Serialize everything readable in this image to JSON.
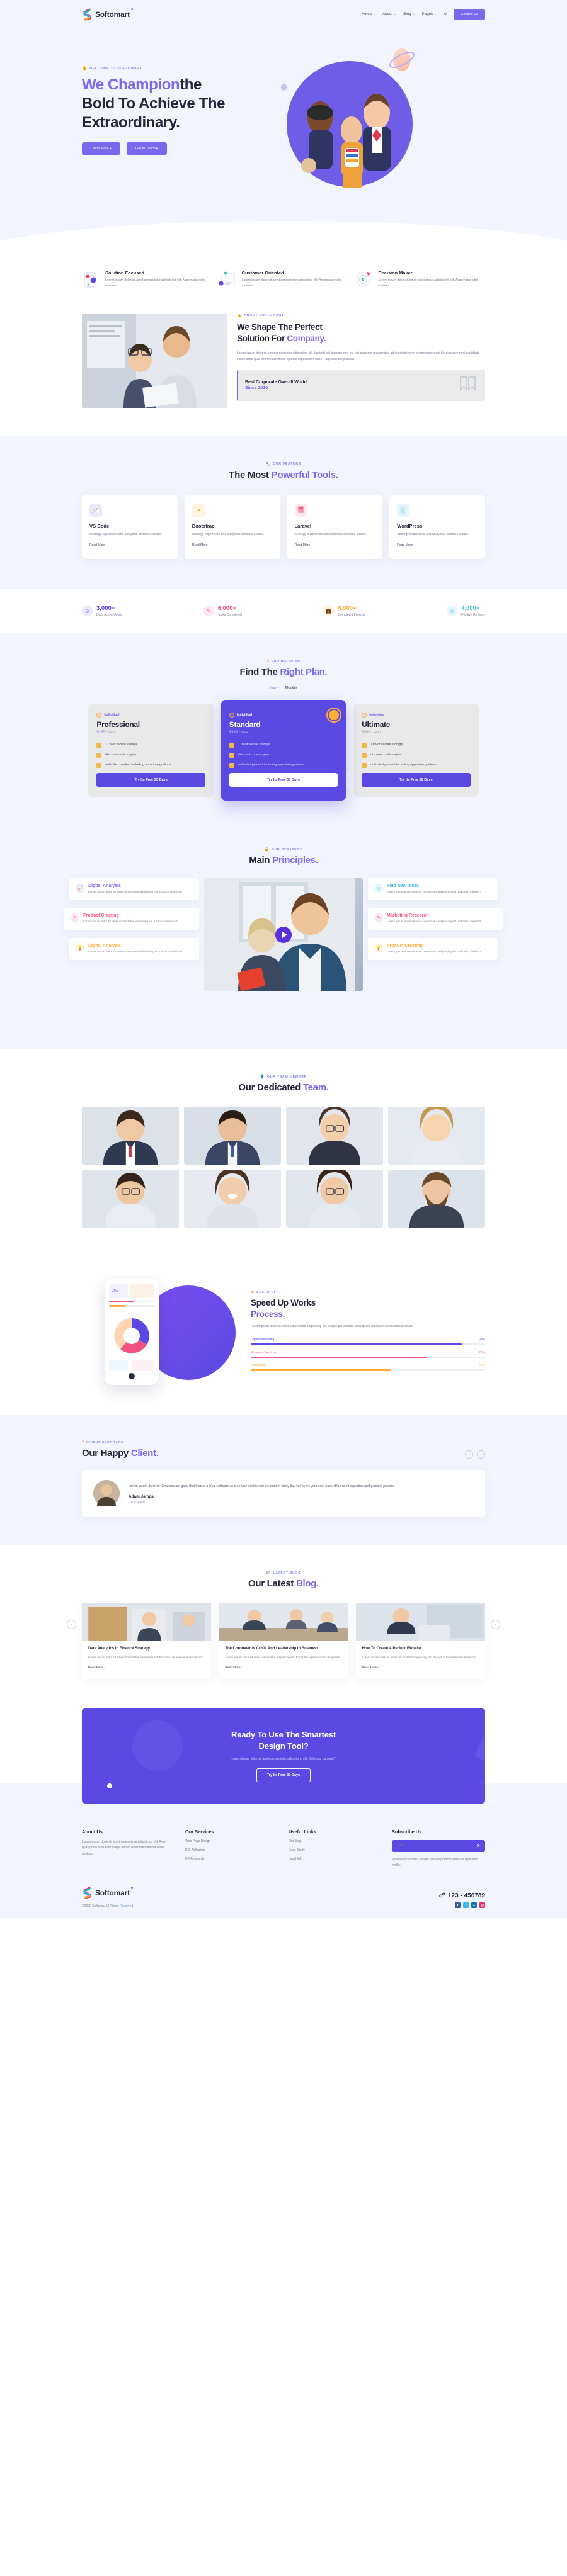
{
  "brand": {
    "name": "Softomart",
    "accent": "#7b68ee"
  },
  "header": {
    "nav": [
      {
        "label": "Home",
        "caret": true
      },
      {
        "label": "About",
        "caret": true
      },
      {
        "label": "Blog",
        "caret": true
      },
      {
        "label": "Pages",
        "caret": true
      }
    ],
    "search_icon": "search-icon",
    "cta": "Contact Us"
  },
  "hero": {
    "eyebrow": "WELCOME TO SOFTOMART",
    "title_accent": "We Champion",
    "title_rest": "the",
    "title_line2": "Bold To Achieve The",
    "title_line3": "Extraordinary.",
    "btn_primary": "Learn More",
    "btn_secondary": "Get In Touch"
  },
  "features": [
    {
      "title": "Solution Focused",
      "desc": "Lorem ipsum dolor sit,amet consectetur adipisicing elit. Aspernatur odio maiores.",
      "icon": "card-shape-icon"
    },
    {
      "title": "Customer Oriented",
      "desc": "Lorem ipsum dolor sit,amet consectetur adipisicing elit. Aspernatur odio maiores.",
      "icon": "node-network-icon"
    },
    {
      "title": "Decision Maker",
      "desc": "Lorem ipsum dolor sit,amet consectetur adipisicing elit. Aspernatur odio maiores.",
      "icon": "target-icon"
    }
  ],
  "about": {
    "eyebrow": "ABOUT SOFTOMART",
    "title1": "We Shape The Perfect",
    "title2": "Solution For ",
    "title_accent": "Company.",
    "paragraph": "Lorem ipsum dolor,sit amet consectetur adipisicing elit. Veritatis vel aperiam non est nisi sapiente recusandae ad exercitationem temporibus sequi hic eius commodi,cupiditate consectetur quia dolores architecto quidem dignissimos unde. Repudiandae pariatur.",
    "award_title": "Best Corporate Overall World",
    "award_since": "Since 2010"
  },
  "tools": {
    "eyebrow": "OUR FEATURE",
    "title": "The Most ",
    "title_accent": "Powerful Tools.",
    "cards": [
      {
        "name": "VS Code",
        "desc": "Strategy experience and analytical combine enable.",
        "more": "Read More",
        "icon": "chart-line-icon",
        "bg": "#ebe8fd",
        "fg": "#6f5de8"
      },
      {
        "name": "Bootstrap",
        "desc": "Strategy experience and analytical combine enable.",
        "more": "Read More",
        "icon": "pie-chart-icon",
        "bg": "#fff3e0",
        "fg": "#ffab3f"
      },
      {
        "name": "Laravel",
        "desc": "Strategy experience and analytical combine enable.",
        "more": "Read More",
        "icon": "monitor-icon",
        "bg": "#fde8ee",
        "fg": "#f2537e"
      },
      {
        "name": "WordPress",
        "desc": "Strategy experience and analytical combine enable.",
        "more": "Read More",
        "icon": "wordpress-icon",
        "bg": "#e2f6fb",
        "fg": "#3bb8dd"
      }
    ]
  },
  "counters": [
    {
      "value": "3,000+",
      "label": "Daily Active Users",
      "color": "#5a4ae3",
      "bg": "#ebe8fd",
      "icon": "user-icon"
    },
    {
      "value": "6,000+",
      "label": "Tasks Completed",
      "color": "#f2537e",
      "bg": "#fde8ee",
      "icon": "edit-icon"
    },
    {
      "value": "8,000+",
      "label": "Completed Projects",
      "color": "#ffab3f",
      "bg": "#fff3e0",
      "icon": "briefcase-icon"
    },
    {
      "value": "4,000+",
      "label": "Positive Reviews",
      "color": "#3bb8dd",
      "bg": "#e2f6fb",
      "icon": "smile-icon"
    }
  ],
  "pricing": {
    "eyebrow": "PRICING PLAN",
    "title": "Find The ",
    "title_accent": "Right Plan.",
    "toggle_yearly": "Yearly",
    "toggle_monthly": "Monthly",
    "plans": [
      {
        "tag": "Individual",
        "name": "Professional",
        "price": "$120",
        "period": " / Year",
        "features": [
          "1TB of secure storage",
          "discount code engine",
          "unlimited product including apps intergrations"
        ],
        "button": "Try Its Free 30 Days",
        "highlight": false
      },
      {
        "tag": "Individual",
        "name": "Standard",
        "price": "$399",
        "period": " / Year",
        "features": [
          "1TB of secure storage",
          "discount code engine",
          "unlimited product including apps intergrations"
        ],
        "button": "Try Its Free 30 Days",
        "highlight": true
      },
      {
        "tag": "Individual",
        "name": "Ultimate",
        "price": "$999",
        "period": " / Year",
        "features": [
          "1TB of secure storage",
          "discount code engine",
          "unlimited product including apps intergrations"
        ],
        "button": "Try Its Free 30 Days",
        "highlight": false
      }
    ]
  },
  "principles": {
    "eyebrow": "OUR STRATEGY",
    "title": "Main ",
    "title_accent": "Principles.",
    "left": [
      {
        "title": "Digital Analysis",
        "desc": "Lorem ipsum dolor sit amet consectetur,adipisicing elit. Laborum,minima?",
        "color": "#7b68ee",
        "bg": "#ebe8fd",
        "icon": "chart-icon"
      },
      {
        "title": "Product Creating",
        "desc": "Lorem ipsum dolor sit amet consectetur,adipisicing elit. Laborum,minima?",
        "color": "#f2537e",
        "bg": "#fde8ee",
        "icon": "edit-icon"
      },
      {
        "title": "Digital Analysis",
        "desc": "Lorem ipsum dolor sit amet consectetur,adipisicing elit. Laborum,minima?",
        "color": "#ffab3f",
        "bg": "#fff3e0",
        "icon": "lightbulb-icon"
      }
    ],
    "right": [
      {
        "title": "Find New Ideas",
        "desc": "Lorem ipsum dolor sit amet consectetur,adipisicing elit. Laborum,minima?",
        "color": "#3bb8dd",
        "bg": "#e2f6fb",
        "icon": "smile-icon"
      },
      {
        "title": "Marketing Research",
        "desc": "Lorem ipsum dolor sit amet consectetur,adipisicing elit. Laborum,minima?",
        "color": "#f2537e",
        "bg": "#fde8ee",
        "icon": "edit-icon"
      },
      {
        "title": "Product Creating",
        "desc": "Lorem ipsum dolor sit amet consectetur,adipisicing elit. Laborum,minima?",
        "color": "#ffab3f",
        "bg": "#fff3e0",
        "icon": "lightbulb-icon"
      }
    ]
  },
  "team": {
    "eyebrow": "OUR TEAM MEMBER",
    "title": "Our Dedicated ",
    "title_accent": "Team."
  },
  "process": {
    "eyebrow": "SPEED UP",
    "title": "Speed Up Works",
    "title_accent": "Process.",
    "paragraph": "Lorem ipsum dolor sit amet consectetur adipisicing elit. Eaque perferendis alias quam est!Ipsa,necessitatibus soluta!",
    "chart_data": {
      "type": "bar",
      "orientation": "horizontal",
      "title": "Speed Up Works Process.",
      "categories": [
        "Digital Marketing",
        "Financial Services",
        "Consulting"
      ],
      "values": [
        90,
        75,
        60
      ],
      "value_labels": [
        "90%",
        "75%",
        "60%"
      ],
      "colors": [
        "#5a4ae3",
        "#f2537e",
        "#ffab3f"
      ],
      "xlabel": "",
      "ylabel": "",
      "xlim": [
        0,
        100
      ],
      "grid": false,
      "legend": false
    }
  },
  "testimonial": {
    "eyebrow": "CLIENT FEEDBACK",
    "title": "Our Happy ",
    "title_accent": "Client.",
    "quote": "Lorem ipsum dolor sit !Chances are good that there's a local software as a service solution on the market today that will serve your core back-office need expertise and genuine passion.",
    "name": "Adam Jampa",
    "role": "CEO Google"
  },
  "blog": {
    "eyebrow": "LATEST BLOG",
    "title": "Our Latest ",
    "title_accent": "Blog.",
    "posts": [
      {
        "title": "Data Analytics In Finance Strategy.",
        "desc": "Lorem ipsum dolor sit amet consectetur,adipisicing elit. Excepturi repressionem tempore?",
        "more": "Read More"
      },
      {
        "title": "The Coronavirus Crisis And Leadership In Business.",
        "desc": "Lorem ipsum dolor sit amet consectetur,adipisicing elit. Excepturi repressionem tempore?",
        "more": "Read More"
      },
      {
        "title": "How To Create A Perfect Website.",
        "desc": "Lorem ipsum dolor sit amet consectetur,adipisicing elit. Excepturi repressionem tempore?",
        "more": "Read More"
      }
    ]
  },
  "cta": {
    "line1": "Ready To Use The Smartest",
    "line2": "Design Tool?",
    "paragraph": "Lorem ipsum dolor sit amet consectetur adipisicing elit. Dolorum, cumque?",
    "button": "Try Its Free 30 Days"
  },
  "footer": {
    "about": {
      "heading": "About Us",
      "text": "Lorem ipsum dolor sit amet consectetur adipisicing elit. Amet quas,porro nisi ullam saepe harum exercitationem sapiente nostrum."
    },
    "services": {
      "heading": "Our Services",
      "items": [
        "Web Page Design",
        "IOS Aplication",
        "UX Research"
      ]
    },
    "links": {
      "heading": "Useful Links",
      "items": [
        "Our Blog",
        "Case Study",
        "Legal Info"
      ]
    },
    "subscribe": {
      "heading": "Subscribe Us",
      "placeholder": "Email",
      "value": "",
      "note": "Vestibulum commo sapien non elit porttitor;vitae volutpat nibh mollis.",
      "send_icon": "send-icon"
    },
    "copyright_pre": "©2020 Softoma. All Rights ",
    "copyright_link": "Reserved.",
    "phone": "123 - 456789",
    "phone_icon": "headset-icon",
    "socials": [
      {
        "name": "facebook-icon",
        "glyph": "f",
        "bg": "#3b5998"
      },
      {
        "name": "twitter-icon",
        "glyph": "t",
        "bg": "#3bb8f0"
      },
      {
        "name": "linkedin-icon",
        "glyph": "in",
        "bg": "#0e76a8"
      },
      {
        "name": "instagram-icon",
        "glyph": "◎",
        "bg": "#e1306c"
      }
    ]
  }
}
